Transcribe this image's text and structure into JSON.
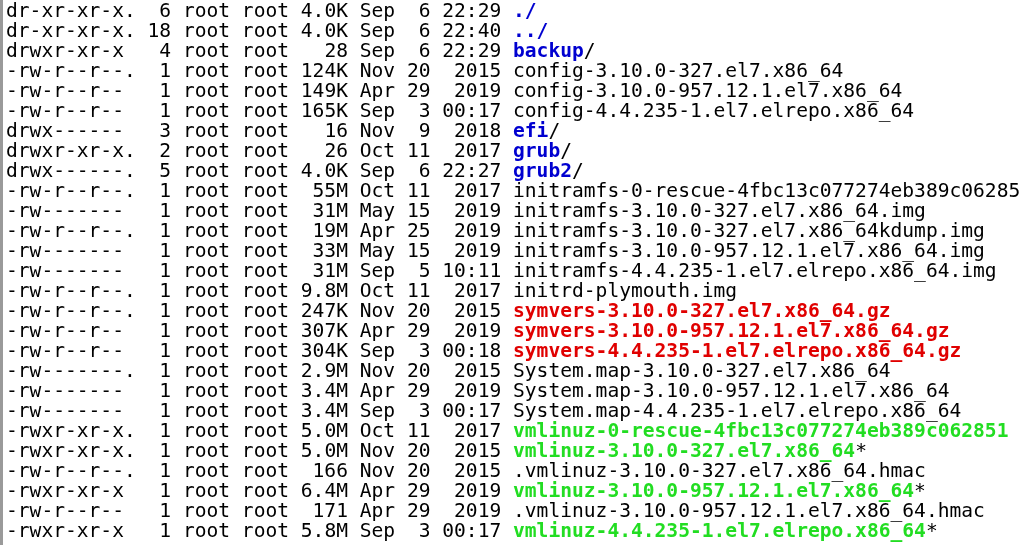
{
  "listing": [
    {
      "permissions": "dr-xr-xr-x.",
      "links": "6",
      "owner": "root",
      "group": "root",
      "size": "4.0K",
      "month": "Sep",
      "day": "6",
      "time": "22:29",
      "name": "./",
      "kind": "directory"
    },
    {
      "permissions": "dr-xr-xr-x.",
      "links": "18",
      "owner": "root",
      "group": "root",
      "size": "4.0K",
      "month": "Sep",
      "day": "6",
      "time": "22:40",
      "name": "../",
      "kind": "directory"
    },
    {
      "permissions": "drwxr-xr-x",
      "links": "4",
      "owner": "root",
      "group": "root",
      "size": "28",
      "month": "Sep",
      "day": "6",
      "time": "22:29",
      "name": "backup",
      "indicator": "/",
      "kind": "directory"
    },
    {
      "permissions": "-rw-r--r--.",
      "links": "1",
      "owner": "root",
      "group": "root",
      "size": "124K",
      "month": "Nov",
      "day": "20",
      "time": "2015",
      "name": "config-3.10.0-327.el7.x86_64",
      "kind": "file"
    },
    {
      "permissions": "-rw-r--r--",
      "links": "1",
      "owner": "root",
      "group": "root",
      "size": "149K",
      "month": "Apr",
      "day": "29",
      "time": "2019",
      "name": "config-3.10.0-957.12.1.el7.x86_64",
      "kind": "file"
    },
    {
      "permissions": "-rw-r--r--",
      "links": "1",
      "owner": "root",
      "group": "root",
      "size": "165K",
      "month": "Sep",
      "day": "3",
      "time": "00:17",
      "name": "config-4.4.235-1.el7.elrepo.x86_64",
      "kind": "file"
    },
    {
      "permissions": "drwx------",
      "links": "3",
      "owner": "root",
      "group": "root",
      "size": "16",
      "month": "Nov",
      "day": "9",
      "time": "2018",
      "name": "efi",
      "indicator": "/",
      "kind": "directory"
    },
    {
      "permissions": "drwxr-xr-x.",
      "links": "2",
      "owner": "root",
      "group": "root",
      "size": "26",
      "month": "Oct",
      "day": "11",
      "time": "2017",
      "name": "grub",
      "indicator": "/",
      "kind": "directory"
    },
    {
      "permissions": "drwx------.",
      "links": "5",
      "owner": "root",
      "group": "root",
      "size": "4.0K",
      "month": "Sep",
      "day": "6",
      "time": "22:27",
      "name": "grub2",
      "indicator": "/",
      "kind": "directory"
    },
    {
      "permissions": "-rw-r--r--.",
      "links": "1",
      "owner": "root",
      "group": "root",
      "size": "55M",
      "month": "Oct",
      "day": "11",
      "time": "2017",
      "name": "initramfs-0-rescue-4fbc13c077274eb389c06285",
      "kind": "file"
    },
    {
      "permissions": "-rw-------",
      "links": "1",
      "owner": "root",
      "group": "root",
      "size": "31M",
      "month": "May",
      "day": "15",
      "time": "2019",
      "name": "initramfs-3.10.0-327.el7.x86_64.img",
      "kind": "file"
    },
    {
      "permissions": "-rw-r--r--.",
      "links": "1",
      "owner": "root",
      "group": "root",
      "size": "19M",
      "month": "Apr",
      "day": "25",
      "time": "2019",
      "name": "initramfs-3.10.0-327.el7.x86_64kdump.img",
      "kind": "file"
    },
    {
      "permissions": "-rw-------",
      "links": "1",
      "owner": "root",
      "group": "root",
      "size": "33M",
      "month": "May",
      "day": "15",
      "time": "2019",
      "name": "initramfs-3.10.0-957.12.1.el7.x86_64.img",
      "kind": "file"
    },
    {
      "permissions": "-rw-------",
      "links": "1",
      "owner": "root",
      "group": "root",
      "size": "31M",
      "month": "Sep",
      "day": "5",
      "time": "10:11",
      "name": "initramfs-4.4.235-1.el7.elrepo.x86_64.img",
      "kind": "file"
    },
    {
      "permissions": "-rw-r--r--.",
      "links": "1",
      "owner": "root",
      "group": "root",
      "size": "9.8M",
      "month": "Oct",
      "day": "11",
      "time": "2017",
      "name": "initrd-plymouth.img",
      "kind": "file"
    },
    {
      "permissions": "-rw-r--r--.",
      "links": "1",
      "owner": "root",
      "group": "root",
      "size": "247K",
      "month": "Nov",
      "day": "20",
      "time": "2015",
      "name": "symvers-3.10.0-327.el7.x86_64.gz",
      "kind": "archive"
    },
    {
      "permissions": "-rw-r--r--",
      "links": "1",
      "owner": "root",
      "group": "root",
      "size": "307K",
      "month": "Apr",
      "day": "29",
      "time": "2019",
      "name": "symvers-3.10.0-957.12.1.el7.x86_64.gz",
      "kind": "archive"
    },
    {
      "permissions": "-rw-r--r--",
      "links": "1",
      "owner": "root",
      "group": "root",
      "size": "304K",
      "month": "Sep",
      "day": "3",
      "time": "00:18",
      "name": "symvers-4.4.235-1.el7.elrepo.x86_64.gz",
      "kind": "archive"
    },
    {
      "permissions": "-rw-------.",
      "links": "1",
      "owner": "root",
      "group": "root",
      "size": "2.9M",
      "month": "Nov",
      "day": "20",
      "time": "2015",
      "name": "System.map-3.10.0-327.el7.x86_64",
      "kind": "file"
    },
    {
      "permissions": "-rw-------",
      "links": "1",
      "owner": "root",
      "group": "root",
      "size": "3.4M",
      "month": "Apr",
      "day": "29",
      "time": "2019",
      "name": "System.map-3.10.0-957.12.1.el7.x86_64",
      "kind": "file"
    },
    {
      "permissions": "-rw-------",
      "links": "1",
      "owner": "root",
      "group": "root",
      "size": "3.4M",
      "month": "Sep",
      "day": "3",
      "time": "00:17",
      "name": "System.map-4.4.235-1.el7.elrepo.x86_64",
      "kind": "file"
    },
    {
      "permissions": "-rwxr-xr-x.",
      "links": "1",
      "owner": "root",
      "group": "root",
      "size": "5.0M",
      "month": "Oct",
      "day": "11",
      "time": "2017",
      "name": "vmlinuz-0-rescue-4fbc13c077274eb389c062851",
      "kind": "executable"
    },
    {
      "permissions": "-rwxr-xr-x.",
      "links": "1",
      "owner": "root",
      "group": "root",
      "size": "5.0M",
      "month": "Nov",
      "day": "20",
      "time": "2015",
      "name": "vmlinuz-3.10.0-327.el7.x86_64",
      "indicator": "*",
      "kind": "executable"
    },
    {
      "permissions": "-rw-r--r--.",
      "links": "1",
      "owner": "root",
      "group": "root",
      "size": "166",
      "month": "Nov",
      "day": "20",
      "time": "2015",
      "name": ".vmlinuz-3.10.0-327.el7.x86_64.hmac",
      "kind": "file"
    },
    {
      "permissions": "-rwxr-xr-x",
      "links": "1",
      "owner": "root",
      "group": "root",
      "size": "6.4M",
      "month": "Apr",
      "day": "29",
      "time": "2019",
      "name": "vmlinuz-3.10.0-957.12.1.el7.x86_64",
      "indicator": "*",
      "kind": "executable"
    },
    {
      "permissions": "-rw-r--r--",
      "links": "1",
      "owner": "root",
      "group": "root",
      "size": "171",
      "month": "Apr",
      "day": "29",
      "time": "2019",
      "name": ".vmlinuz-3.10.0-957.12.1.el7.x86_64.hmac",
      "kind": "file"
    },
    {
      "permissions": "-rwxr-xr-x",
      "links": "1",
      "owner": "root",
      "group": "root",
      "size": "5.8M",
      "month": "Sep",
      "day": "3",
      "time": "00:17",
      "name": "vmlinuz-4.4.235-1.el7.elrepo.x86_64",
      "indicator": "*",
      "kind": "executable"
    }
  ]
}
